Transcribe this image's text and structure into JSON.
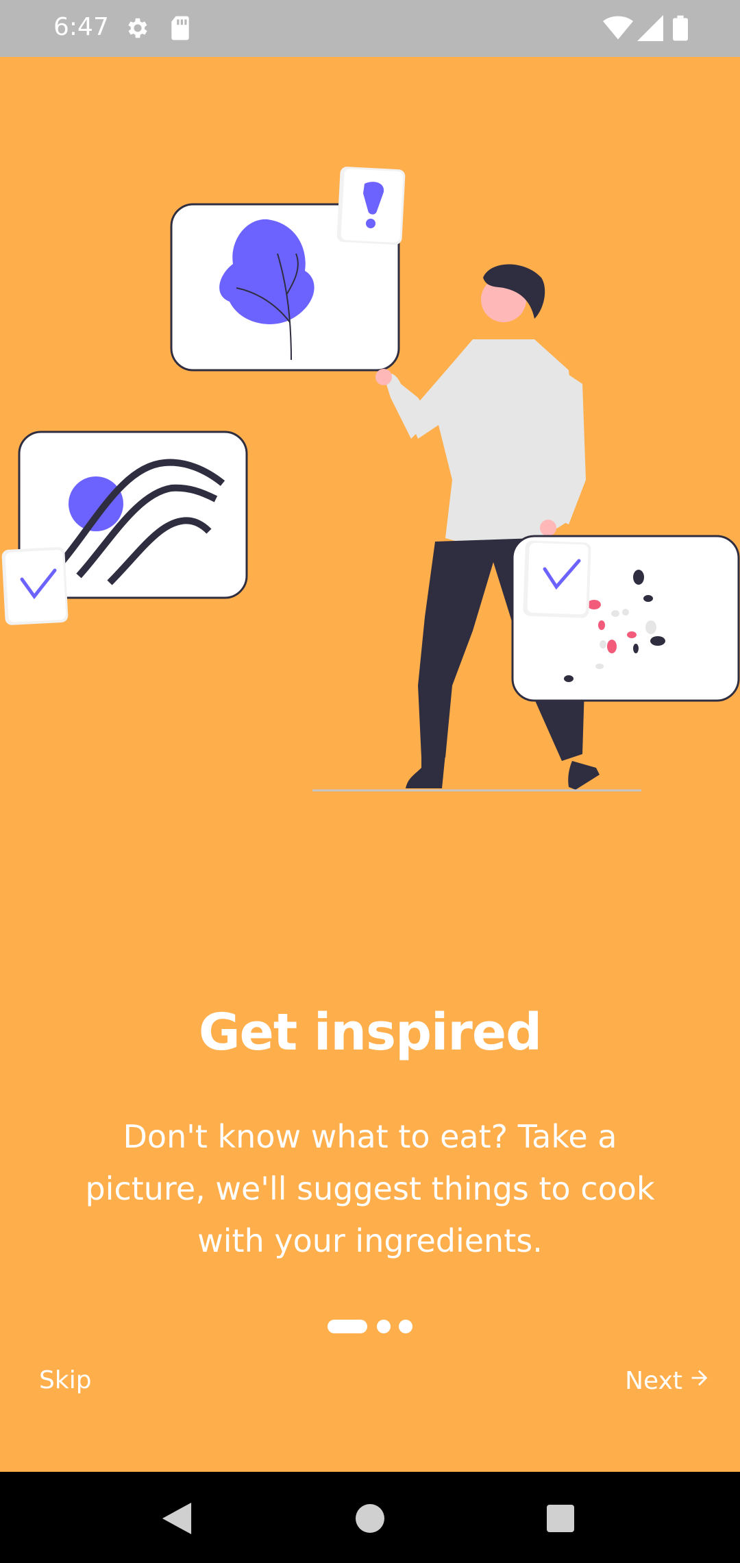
{
  "status_bar": {
    "time": "6:47",
    "icons": [
      "settings-gear-icon",
      "sd-card-icon",
      "wifi-icon",
      "signal-icon",
      "battery-icon"
    ]
  },
  "onboarding": {
    "title": "Get inspired",
    "description": "Don't know what to eat? Take a picture, we'll suggest things to cook with your ingredients.",
    "page_indicator": {
      "total": 3,
      "active_index": 0
    },
    "skip_label": "Skip",
    "next_label": "Next",
    "next_icon": "arrow-right-icon"
  },
  "colors": {
    "background": "#FFAE4C",
    "status_bar": "#B8B8B8",
    "accent_purple": "#6C63FF",
    "dark": "#2F2E41",
    "highlight_pink": "#F25C7A"
  },
  "nav_bar": {
    "icons": [
      "back-triangle-icon",
      "home-circle-icon",
      "recents-square-icon"
    ]
  }
}
